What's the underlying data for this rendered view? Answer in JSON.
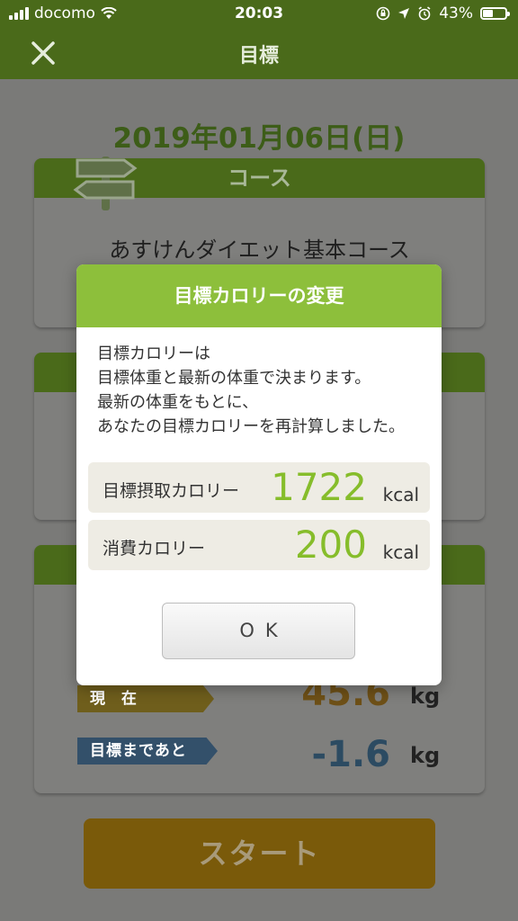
{
  "status_bar": {
    "carrier": "docomo",
    "time": "20:03",
    "battery": "43%"
  },
  "header": {
    "title": "目標"
  },
  "date": "2019年01月06日(日)",
  "course_card": {
    "heading": "コース",
    "course_name": "あすけんダイエット基本コース"
  },
  "weight_card": {
    "current_label": "現 在",
    "current_value": "45.6",
    "remaining_label": "目標まであと",
    "remaining_value": "-1.6",
    "unit": "kg"
  },
  "start_button": "スタート",
  "dialog": {
    "title": "目標カロリーの変更",
    "lines": [
      "目標カロリーは",
      "目標体重と最新の体重で決まります。",
      "最新の体重をもとに、",
      "あなたの目標カロリーを再計算しました。"
    ],
    "intake": {
      "label": "目標摂取カロリー",
      "value": "1722",
      "unit": "kcal"
    },
    "burn": {
      "label": "消費カロリー",
      "value": "200",
      "unit": "kcal"
    },
    "ok_label": "OK"
  },
  "colors": {
    "header_green": "#4a6a1a",
    "dialog_green": "#8dbf3b",
    "value_green": "#86bd2b"
  }
}
